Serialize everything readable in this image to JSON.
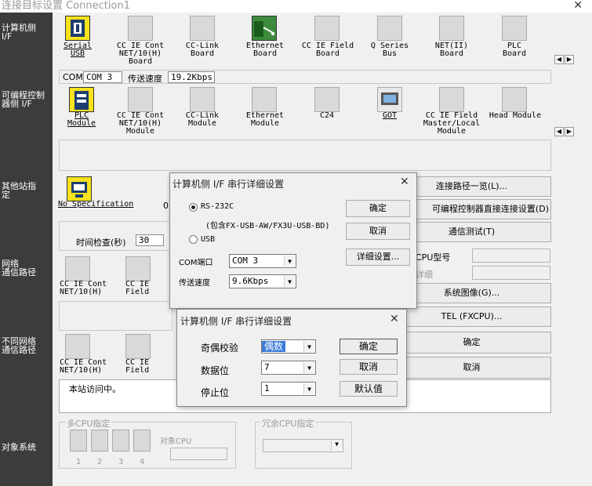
{
  "window": {
    "title": "连接目标设置 Connection1",
    "close": "✕"
  },
  "sidebar": {
    "pc_if": "计算机侧\nI/F",
    "plc_if": "可编程控制\n器侧 I/F",
    "other_station": "其他站指\n定",
    "network_route": "网络\n通信路径",
    "diff_network": "不同网络\n通信路径",
    "target_system": "对象系统"
  },
  "pc_if_items": [
    {
      "label": "Serial\nUSB"
    },
    {
      "label": "CC IE Cont\nNET/10(H)\nBoard"
    },
    {
      "label": "CC-Link\nBoard"
    },
    {
      "label": "Ethernet\nBoard"
    },
    {
      "label": "CC IE Field\nBoard"
    },
    {
      "label": "Q Series\nBus"
    },
    {
      "label": "NET(II)\nBoard"
    },
    {
      "label": "PLC\nBoard"
    }
  ],
  "pc_if_info": {
    "com_label": "COM",
    "com_value": "COM 3",
    "speed_label": "传送速度",
    "speed_value": "19.2Kbps"
  },
  "plc_if_items": [
    {
      "label": "PLC\nModule"
    },
    {
      "label": "CC IE Cont\nNET/10(H)\nModule"
    },
    {
      "label": "CC-Link\nModule"
    },
    {
      "label": "Ethernet\nModule"
    },
    {
      "label": "C24"
    },
    {
      "label": "GOT"
    },
    {
      "label": "CC IE Field\nMaster/Local\nModule"
    },
    {
      "label": "Head Module"
    }
  ],
  "other_station": {
    "label": "No Specification",
    "partial": "0",
    "time_check_label": "时间检查(秒)",
    "time_check_value": "30"
  },
  "network_items": [
    {
      "label": "CC IE Cont\nNET/10(H)"
    },
    {
      "label": "CC IE\nField"
    }
  ],
  "diff_network_items": [
    {
      "label": "CC IE Cont\nNET/10(H)"
    },
    {
      "label": "CC IE\nField"
    }
  ],
  "status_text": "本站访问中。",
  "right_buttons": {
    "route_list": "连接路径一览(L)...",
    "direct_connect": "可编程控制器直接连接设置(D)",
    "comm_test": "通信测试(T)",
    "cpu_type": "CPU型号",
    "detail": "详细",
    "system_image": "系统图像(G)...",
    "tel": "TEL (FXCPU)...",
    "ok": "确定",
    "cancel": "取消"
  },
  "multi_cpu": {
    "legend": "多CPU指定",
    "target_label": "对象CPU",
    "numbers": [
      "1",
      "2",
      "3",
      "4"
    ]
  },
  "redundant_cpu": {
    "legend": "冗余CPU指定"
  },
  "dialog1": {
    "title": "计算机侧 I/F 串行详细设置",
    "rs232c": "RS-232C",
    "rs232c_note": "(包含FX-USB-AW/FX3U-USB-BD)",
    "usb": "USB",
    "com_port_label": "COM端口",
    "com_port_value": "COM 3",
    "speed_label": "传送速度",
    "speed_value": "9.6Kbps",
    "ok": "确定",
    "cancel": "取消",
    "detail": "详细设置..."
  },
  "dialog2": {
    "title": "计算机侧 I/F 串行详细设置",
    "parity_label": "奇偶校验",
    "parity_value": "偶数",
    "data_bits_label": "数据位",
    "data_bits_value": "7",
    "stop_bits_label": "停止位",
    "stop_bits_value": "1",
    "ok": "确定",
    "cancel": "取消",
    "default": "默认值"
  }
}
